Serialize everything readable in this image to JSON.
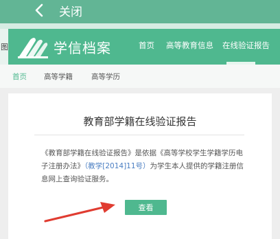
{
  "appbar": {
    "back_icon": "chevron-left-icon",
    "close_label": "关闭"
  },
  "left_strip": {
    "text": "图"
  },
  "header": {
    "brand_icon": "book-pages-icon",
    "brand_name": "学信档案",
    "nav": [
      {
        "label": "首页"
      },
      {
        "label": "高等教育信息"
      },
      {
        "label": "在线验证报告"
      }
    ]
  },
  "subnav": [
    {
      "label": "首页"
    },
    {
      "label": "高等学籍"
    },
    {
      "label": "高等学历"
    }
  ],
  "card": {
    "title": "教育部学籍在线验证报告",
    "desc_part1": "《教育部学籍在线验证报告》是依据《高等学校学生学籍学历电子注册办法》",
    "desc_link": "（教学[2014]11号）",
    "desc_part2": "为学生本人提供的学籍注册信息网上查询验证服务。",
    "view_button": "查看"
  },
  "colors": {
    "brand_green": "#4fb88f",
    "annotation_red": "#e03c31"
  }
}
